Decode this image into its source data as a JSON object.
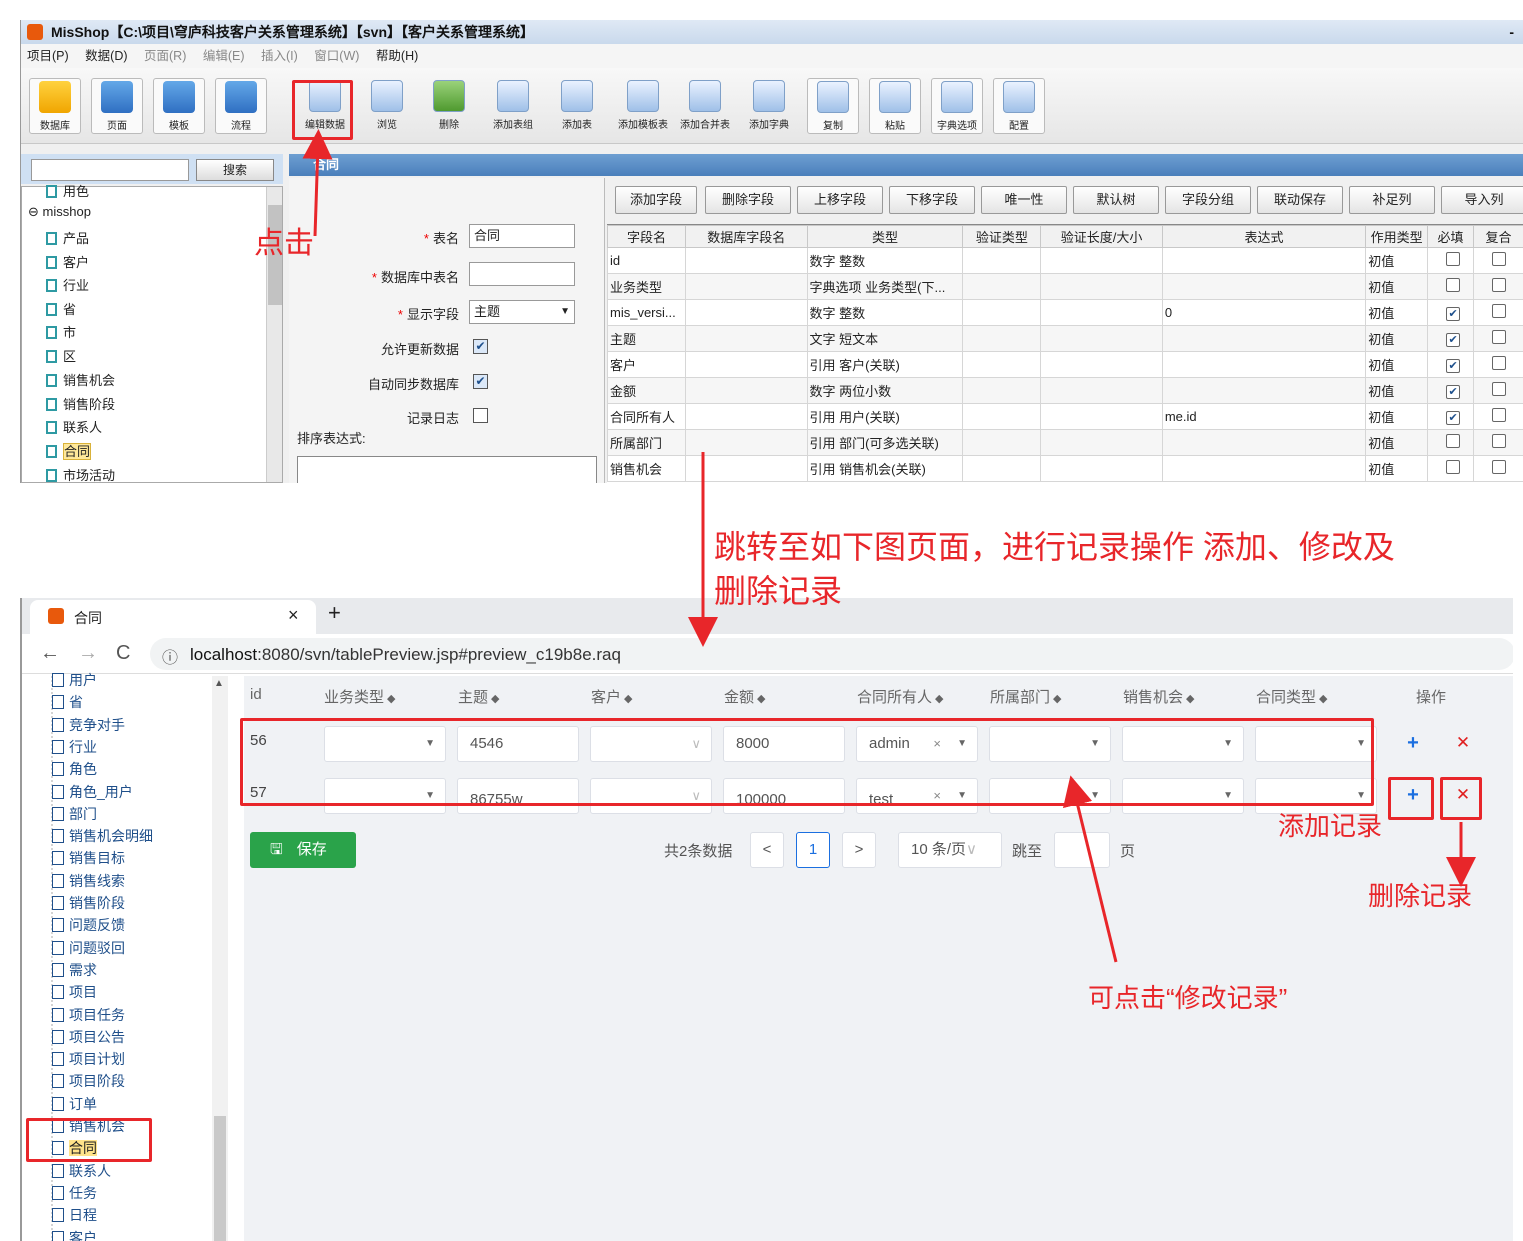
{
  "app": {
    "title": "MisShop【C:\\项目\\穹庐科技客户关系管理系统】【svn】【客户关系管理系统】",
    "min_icon": "-",
    "menu": [
      "项目(P)",
      "数据(D)",
      "页面(R)",
      "编辑(E)",
      "插入(I)",
      "窗口(W)",
      "帮助(H)"
    ],
    "toolbar": [
      "数据库",
      "页面",
      "模板",
      "流程",
      "编辑数据",
      "浏览",
      "删除",
      "添加表组",
      "添加表",
      "添加模板表",
      "添加合并表",
      "添加字典",
      "复制",
      "粘贴",
      "字典选项",
      "配置"
    ],
    "search_button": "搜索",
    "tree": [
      "用色",
      "misshop",
      "产品",
      "客户",
      "行业",
      "省",
      "市",
      "区",
      "销售机会",
      "销售阶段",
      "联系人",
      "合同",
      "市场活动"
    ],
    "panel_title": "合同",
    "form": {
      "table_name_label": "表名",
      "table_name_value": "合同",
      "db_table_label": "数据库中表名",
      "db_table_value": "",
      "display_field_label": "显示字段",
      "display_field_value": "主题",
      "allow_update_label": "允许更新数据",
      "auto_sync_label": "自动同步数据库",
      "log_label": "记录日志",
      "sort_label": "排序表达式:",
      "checked_mark": "✔"
    },
    "field_buttons": [
      "添加字段",
      "删除字段",
      "上移字段",
      "下移字段",
      "唯一性",
      "默认树",
      "字段分组",
      "联动保存",
      "补足列",
      "导入列"
    ],
    "grid_headers": [
      "字段名",
      "数据库字段名",
      "类型",
      "验证类型",
      "验证长度/大小",
      "表达式",
      "作用类型",
      "必填",
      "复合"
    ],
    "grid_rows": [
      {
        "name": "id",
        "type": "数字  整数",
        "expr": "",
        "scope": "初值",
        "required": false
      },
      {
        "name": "业务类型",
        "type": "字典选项  业务类型(下...",
        "expr": "",
        "scope": "初值",
        "required": false
      },
      {
        "name": "mis_versi...",
        "type": "数字  整数",
        "expr": "0",
        "scope": "初值",
        "required": true
      },
      {
        "name": "主题",
        "type": "文字  短文本",
        "expr": "",
        "scope": "初值",
        "required": true
      },
      {
        "name": "客户",
        "type": "引用  客户(关联)",
        "expr": "",
        "scope": "初值",
        "required": true
      },
      {
        "name": "金额",
        "type": "数字  两位小数",
        "expr": "",
        "scope": "初值",
        "required": true
      },
      {
        "name": "合同所有人",
        "type": "引用  用户(关联)",
        "expr": "me.id",
        "scope": "初值",
        "required": true
      },
      {
        "name": "所属部门",
        "type": "引用  部门(可多选关联)",
        "expr": "",
        "scope": "初值",
        "required": false
      },
      {
        "name": "销售机会",
        "type": "引用  销售机会(关联)",
        "expr": "",
        "scope": "初值",
        "required": false
      }
    ]
  },
  "browser": {
    "tab_title": "合同",
    "tab_close": "×",
    "tab_new": "+",
    "nav": {
      "back": "←",
      "forward": "→",
      "reload": "C",
      "info": "ⓘ"
    },
    "url_host": "localhost",
    "url_rest": ":8080/svn/tablePreview.jsp#preview_c19b8e.raq",
    "tree": [
      "用户",
      "省",
      "竞争对手",
      "行业",
      "角色",
      "角色_用户",
      "部门",
      "销售机会明细",
      "销售目标",
      "销售线索",
      "销售阶段",
      "问题反馈",
      "问题驳回",
      "需求",
      "项目",
      "项目任务",
      "项目公告",
      "项目计划",
      "项目阶段",
      "订单",
      "销售机会",
      "合同",
      "联系人",
      "任务",
      "日程",
      "客户"
    ],
    "columns": [
      "id",
      "业务类型",
      "主题",
      "客户",
      "金额",
      "合同所有人",
      "所属部门",
      "销售机会",
      "合同类型",
      "操作"
    ],
    "sort_icon": "◆",
    "rows": [
      {
        "id": "56",
        "topic": "4546",
        "amount": "8000",
        "owner": "admin"
      },
      {
        "id": "57",
        "topic": "86755w",
        "amount": "100000",
        "owner": "test"
      }
    ],
    "add_icon": "+",
    "delete_icon": "✕",
    "clear_icon": "×",
    "dropdown_icon": "▼",
    "chevron_icon": "∨",
    "save_label": "保存",
    "save_icon": "🖫",
    "pager": {
      "total": "共2条数据",
      "prev": "<",
      "current": "1",
      "next": ">",
      "size": "10 条/页",
      "size_arrow": "∨",
      "jump": "跳至",
      "page": "页"
    }
  },
  "annotations": {
    "click": "点击",
    "jump_line1": "跳转至如下图页面，进行记录操作 添加、修改及",
    "jump_line2": "删除记录",
    "add_record": "添加记录",
    "delete_record": "删除记录",
    "edit_record": "可点击“修改记录”"
  },
  "colors": {
    "annotation_red": "#e8262a",
    "save_green": "#2aa34a",
    "accent_blue": "#1b6fe0"
  }
}
